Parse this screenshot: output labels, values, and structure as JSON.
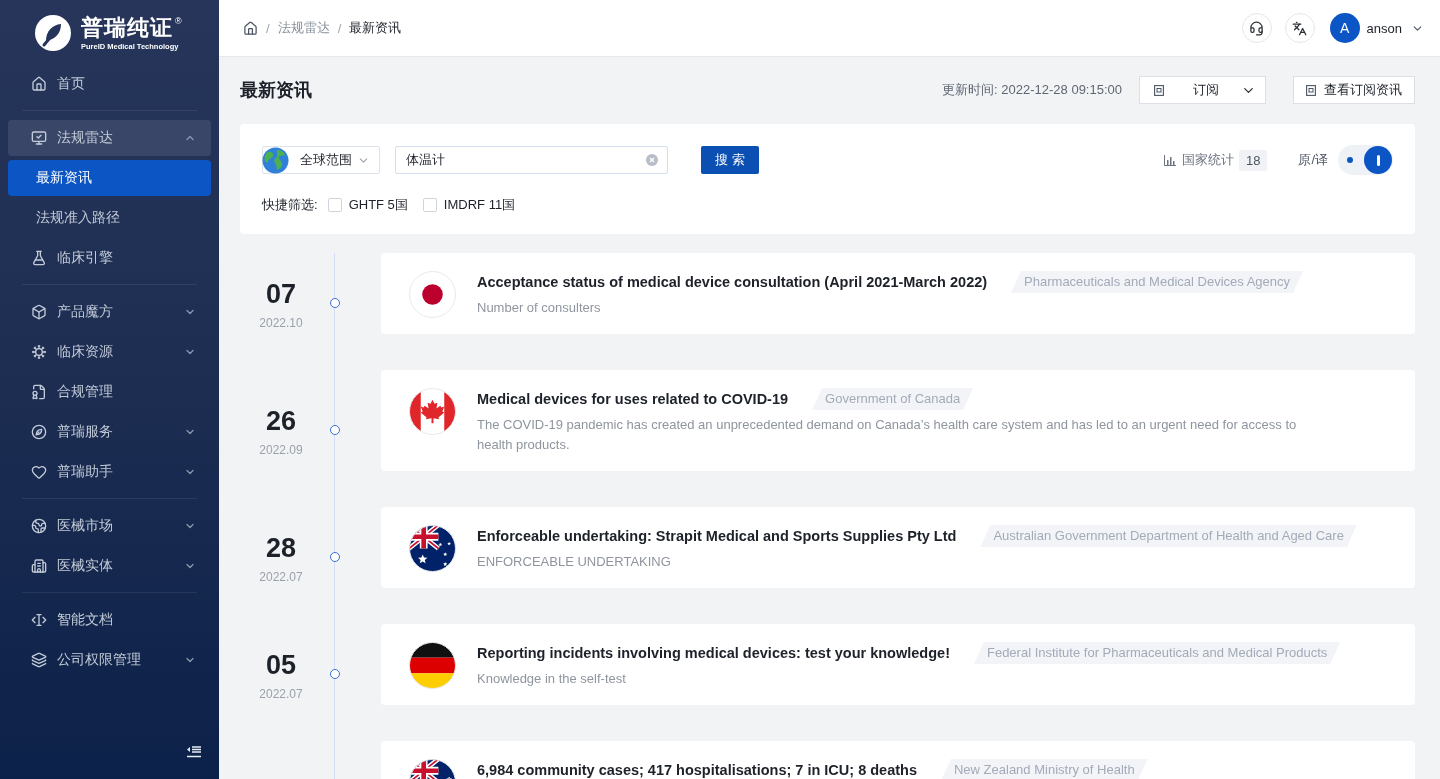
{
  "sidebar": {
    "logo": {
      "name": "普瑞纯证$^{®}$",
      "tagline": "PureID Medical Technology"
    },
    "groups": [
      {
        "items": [
          {
            "kind": "link",
            "label": "首页",
            "selected": false
          }
        ]
      },
      {
        "items": [
          {
            "kind": "submenu",
            "label": "法规雷达",
            "selected": false,
            "expanded": true,
            "children": [
              {
                "label": "最新资讯",
                "selected": true
              },
              {
                "label": "法规准入路径",
                "selected": false
              }
            ]
          },
          {
            "kind": "link",
            "label": "临床引擎",
            "selected": false
          }
        ]
      },
      {
        "items": [
          {
            "kind": "submenu",
            "label": "产品魔方",
            "selected": false,
            "expanded": false
          },
          {
            "kind": "submenu",
            "label": "临床资源",
            "selected": false,
            "expanded": false
          },
          {
            "kind": "link",
            "label": "合规管理",
            "selected": false
          },
          {
            "kind": "submenu",
            "label": "普瑞服务",
            "selected": false,
            "expanded": false
          },
          {
            "kind": "submenu",
            "label": "普瑞助手",
            "selected": false,
            "expanded": false
          }
        ]
      },
      {
        "items": [
          {
            "kind": "submenu",
            "label": "医械市场",
            "selected": false,
            "expanded": false
          },
          {
            "kind": "submenu",
            "label": "医械实体",
            "selected": false,
            "expanded": false
          }
        ]
      },
      {
        "items": [
          {
            "kind": "link",
            "label": "智能文档",
            "selected": false
          },
          {
            "kind": "submenu",
            "label": "公司权限管理",
            "selected": false,
            "expanded": false
          }
        ]
      }
    ]
  },
  "breadcrumb": [
    {
      "separator": "/",
      "label": "法规雷达"
    },
    {
      "separator": "/",
      "label": "最新资讯"
    }
  ],
  "user": {
    "initial": "A",
    "name": "anson"
  },
  "page_header": {
    "title": "最新资讯",
    "updated_at": "更新时间: 2022-12-28 09:15:00",
    "subscribe_select": {
      "value": "订阅"
    },
    "view_subscriptions_button": "查看订阅资讯"
  },
  "filters": {
    "region_select": {
      "value": "全球范围"
    },
    "search": {
      "value": "体温计"
    },
    "search_button": "搜 索",
    "country_stats": {
      "label": "国家统计",
      "count": "18"
    },
    "original_translation": {
      "label": "原/译",
      "on": true
    },
    "quick_filter": {
      "label": "快捷筛选:",
      "options": [
        {
          "label": "GHTF 5国",
          "checked": false
        },
        {
          "label": "IMDRF 11国",
          "checked": false
        }
      ]
    }
  },
  "news": [
    {
      "day": "07",
      "date": "2022.10",
      "title": "Acceptance status of medical device consultation (April 2021-March 2022)",
      "source": "Pharmaceuticals and Medical Devices Agency",
      "summary": "Number of consulters"
    },
    {
      "day": "26",
      "date": "2022.09",
      "title": "Medical devices for uses related to COVID-19",
      "source": "Government of Canada",
      "summary": "The COVID-19 pandemic has created an unprecedented demand on Canada’s health care system and has led to an urgent need for access to health products."
    },
    {
      "day": "28",
      "date": "2022.07",
      "title": "Enforceable undertaking: Strapit Medical and Sports Supplies Pty Ltd",
      "source": "Australian Government Department of Health and Aged Care",
      "summary": "ENFORCEABLE UNDERTAKING"
    },
    {
      "day": "05",
      "date": "2022.07",
      "title": "Reporting incidents involving medical devices: test your knowledge!",
      "source": "Federal Institute for Pharmaceuticals and Medical Products",
      "summary": "Knowledge in the self-test"
    },
    {
      "title": "6,984 community cases; 417 hospitalisations; 7 in ICU; 8 deaths",
      "source": "New Zealand Ministry of Health"
    }
  ]
}
